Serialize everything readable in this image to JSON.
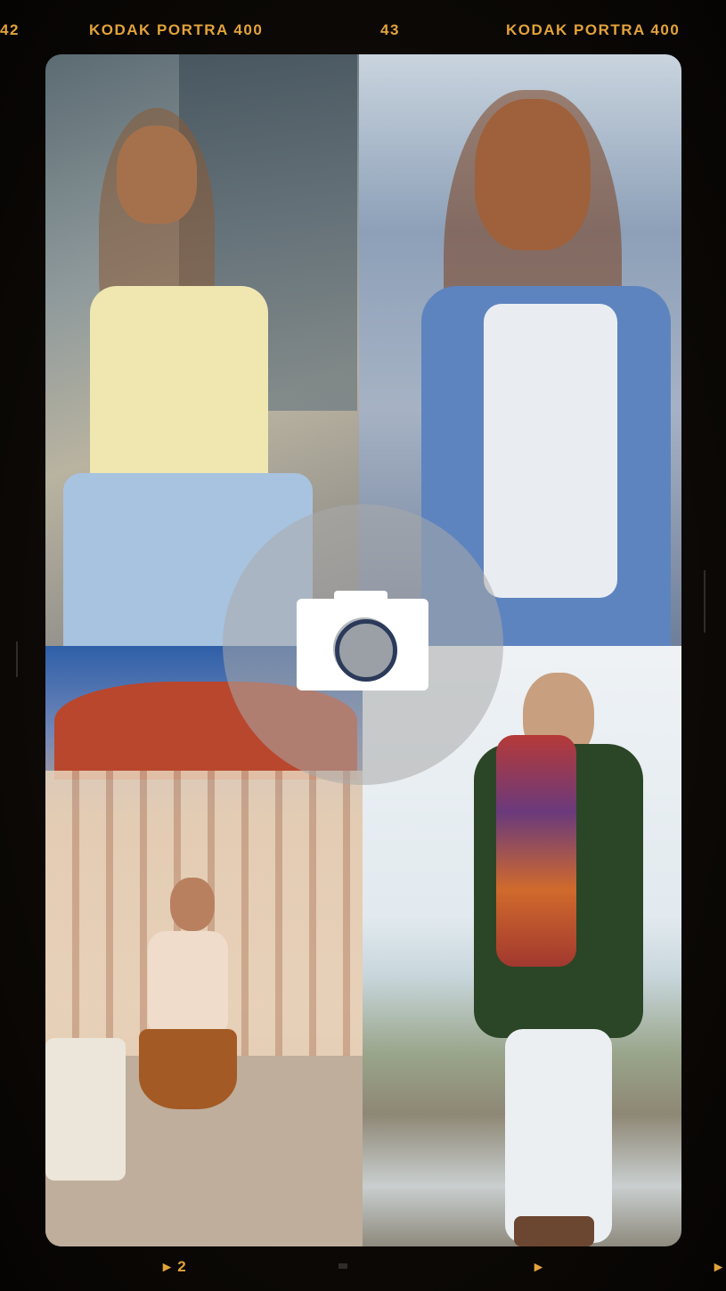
{
  "film_strip": {
    "top_left_number": "42",
    "top_brand_left": "KODAK  PORTRA 400",
    "top_frame_number": "43",
    "top_brand_right": "KODAK  PORTRA 400",
    "bottom_left_marker": "▸ 2",
    "bottom_right_marker": "▸",
    "bottom_edge_marker": "▸"
  },
  "collage": {
    "photos": [
      {
        "name": "woman-yellow-top-city-street"
      },
      {
        "name": "woman-denim-shirt-smiling"
      },
      {
        "name": "woman-sunglasses-historic-building"
      },
      {
        "name": "woman-green-sweater-scarf-beach"
      }
    ]
  },
  "camera_button": {
    "icon": "camera-icon"
  },
  "colors": {
    "film_background": "#0d0906",
    "edge_text": "#e3a33a",
    "camera_overlay": "rgba(170,170,170,0.55)",
    "camera_icon": "#ffffff"
  }
}
